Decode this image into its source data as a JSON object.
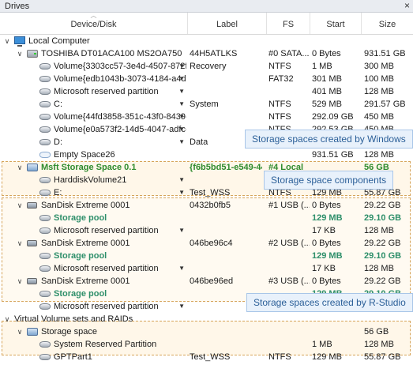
{
  "window": {
    "title": "Drives",
    "close": "×"
  },
  "columns": {
    "device": "Device/Disk",
    "label": "Label",
    "fs": "FS",
    "start": "Start",
    "size": "Size"
  },
  "rows": [
    {
      "indent": 0,
      "exp": "∨",
      "icon": "computer",
      "name": "Local Computer",
      "label": "",
      "fs": "",
      "start": "",
      "size": ""
    },
    {
      "indent": 1,
      "exp": "∨",
      "icon": "hdd",
      "name": "TOSHIBA DT01ACA100 MS2OA750",
      "label": "44H5ATLKS",
      "fs": "#0 SATA...",
      "start": "0 Bytes",
      "size": "931.51 GB"
    },
    {
      "indent": 2,
      "exp": "",
      "icon": "volume",
      "name": "Volume{3303cc57-3e4d-4507-872f-...",
      "dd": true,
      "label": "Recovery",
      "fs": "NTFS",
      "start": "1 MB",
      "size": "300 MB"
    },
    {
      "indent": 2,
      "exp": "",
      "icon": "volume",
      "name": "Volume{edb1043b-3073-4184-a4d5...",
      "dd": true,
      "label": "",
      "fs": "FAT32",
      "start": "301 MB",
      "size": "100 MB"
    },
    {
      "indent": 2,
      "exp": "",
      "icon": "volume",
      "name": "Microsoft reserved partition",
      "dd": true,
      "label": "",
      "fs": "",
      "start": "401 MB",
      "size": "128 MB"
    },
    {
      "indent": 2,
      "exp": "",
      "icon": "volume",
      "name": "C:",
      "dd": true,
      "label": "System",
      "fs": "NTFS",
      "start": "529 MB",
      "size": "291.57 GB"
    },
    {
      "indent": 2,
      "exp": "",
      "icon": "volume",
      "name": "Volume{44fd3858-351c-43f0-8439-1...",
      "dd": true,
      "label": "",
      "fs": "NTFS",
      "start": "292.09 GB",
      "size": "450 MB"
    },
    {
      "indent": 2,
      "exp": "",
      "icon": "volume",
      "name": "Volume{e0a573f2-14d5-4047-adfc-...",
      "dd": true,
      "label": "",
      "fs": "NTFS",
      "start": "292.53 GB",
      "size": "450 MB"
    },
    {
      "indent": 2,
      "exp": "",
      "icon": "volume",
      "name": "D:",
      "dd": true,
      "label": "Data",
      "fs": "",
      "start": "",
      "size": ""
    },
    {
      "indent": 2,
      "exp": "",
      "icon": "empty",
      "name": "Empty Space26",
      "label": "",
      "fs": "",
      "start": "931.51 GB",
      "size": "128 MB"
    },
    {
      "indent": 1,
      "exp": "∨",
      "icon": "pool",
      "name": "Msft Storage Space 0.1",
      "style": "green",
      "label": "{f6b5bd51-e549-44...",
      "fs": "#4 Local",
      "start": "",
      "size": "56 GB"
    },
    {
      "indent": 2,
      "exp": "",
      "icon": "volume",
      "name": "HarddiskVolume21",
      "dd": true,
      "label": "",
      "fs": "",
      "start": "",
      "size": ""
    },
    {
      "indent": 2,
      "exp": "",
      "icon": "volume",
      "name": "E:",
      "dd": true,
      "label": "Test_WSS",
      "fs": "NTFS",
      "start": "129 MB",
      "size": "55.87 GB"
    },
    {
      "indent": 1,
      "exp": "∨",
      "icon": "usb",
      "name": "SanDisk Extreme 0001",
      "label": "0432b0fb5",
      "fs": "#1 USB (...",
      "start": "0 Bytes",
      "size": "29.22 GB"
    },
    {
      "indent": 2,
      "exp": "",
      "icon": "volume",
      "name": "Storage pool",
      "style": "teal",
      "label": "",
      "fs": "",
      "start": "129 MB",
      "size": "29.10 GB",
      "teal": true
    },
    {
      "indent": 2,
      "exp": "",
      "icon": "volume",
      "name": "Microsoft reserved partition",
      "dd": true,
      "label": "",
      "fs": "",
      "start": "17 KB",
      "size": "128 MB"
    },
    {
      "indent": 1,
      "exp": "∨",
      "icon": "usb",
      "name": "SanDisk Extreme 0001",
      "label": "046be96c4",
      "fs": "#2 USB (...",
      "start": "0 Bytes",
      "size": "29.22 GB"
    },
    {
      "indent": 2,
      "exp": "",
      "icon": "volume",
      "name": "Storage pool",
      "style": "teal",
      "label": "",
      "fs": "",
      "start": "129 MB",
      "size": "29.10 GB",
      "teal": true
    },
    {
      "indent": 2,
      "exp": "",
      "icon": "volume",
      "name": "Microsoft reserved partition",
      "dd": true,
      "label": "",
      "fs": "",
      "start": "17 KB",
      "size": "128 MB"
    },
    {
      "indent": 1,
      "exp": "∨",
      "icon": "usb",
      "name": "SanDisk Extreme 0001",
      "label": "046be96ed",
      "fs": "#3 USB (...",
      "start": "0 Bytes",
      "size": "29.22 GB"
    },
    {
      "indent": 2,
      "exp": "",
      "icon": "volume",
      "name": "Storage pool",
      "style": "teal",
      "label": "",
      "fs": "",
      "start": "129 MB",
      "size": "29.10 GB",
      "teal": true
    },
    {
      "indent": 2,
      "exp": "",
      "icon": "volume",
      "name": "Microsoft reserved partition",
      "dd": true,
      "label": "",
      "fs": "",
      "start": "17 KB",
      "size": "128 MB"
    },
    {
      "indent": 0,
      "exp": "∨",
      "icon": "none",
      "name": "Virtual Volume sets and RAIDs",
      "label": "",
      "fs": "",
      "start": "",
      "size": ""
    },
    {
      "indent": 1,
      "exp": "∨",
      "icon": "pool",
      "name": "Storage space",
      "label": "",
      "fs": "",
      "start": "",
      "size": "56 GB"
    },
    {
      "indent": 2,
      "exp": "",
      "icon": "volume",
      "name": "System Reserved Partition",
      "label": "",
      "fs": "",
      "start": "1 MB",
      "size": "128 MB"
    },
    {
      "indent": 2,
      "exp": "",
      "icon": "volume",
      "name": "GPTPart1",
      "label": "Test_WSS",
      "fs": "NTFS",
      "start": "129 MB",
      "size": "55.87 GB"
    }
  ],
  "callouts": {
    "windows": "Storage spaces created by Windows",
    "components": "Storage space components",
    "rstudio": "Storage spaces created by R-Studio"
  }
}
